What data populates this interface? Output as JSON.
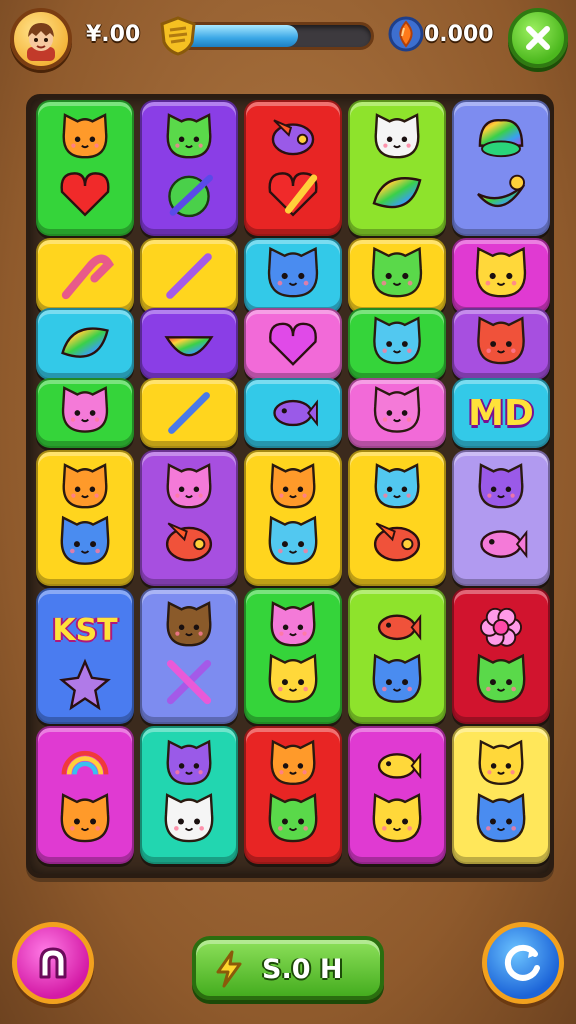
{
  "header": {
    "coin_value": "¥.00",
    "level_progress": 0.62,
    "gem_value": "0.000"
  },
  "footer": {
    "boost_label": "S.0 H"
  },
  "colors": {
    "green": "#35d43a",
    "purple": "#8a3ee6",
    "red": "#e82524",
    "lime": "#8ee32c",
    "periwinkle": "#7d8cf0",
    "yellow": "#ffd51e",
    "cyan": "#33c9e8",
    "magenta": "#e03ad2",
    "pink": "#f26ad8",
    "violet": "#a74fe0",
    "lilac": "#b19af0",
    "blue": "#4a7cf0",
    "crimson": "#d1142e",
    "teal": "#22d6b0",
    "lightyellow": "#ffe75a"
  },
  "board": {
    "tiles": [
      {
        "color": "green",
        "top": "cat-orange",
        "bottom": "heart-red"
      },
      {
        "color": "purple",
        "top": "cat-green",
        "bottom": "apple-pencil"
      },
      {
        "color": "red",
        "top": "bird-purple",
        "bottom": "heart-pencil"
      },
      {
        "color": "lime",
        "top": "cat-white",
        "bottom": "leaf-rainbow"
      },
      {
        "color": "periwinkle",
        "top": "rainbow-blob",
        "bottom": "moon-rainbow"
      },
      {
        "color": "yellow",
        "top": "magnet-pencil",
        "bottom": ""
      },
      {
        "color": "yellow",
        "top": "pencil-purple",
        "bottom": ""
      },
      {
        "color": "cyan",
        "top": "cat-blue",
        "bottom": ""
      },
      {
        "color": "yellow",
        "top": "cat-green",
        "bottom": ""
      },
      {
        "color": "magenta",
        "top": "cat-yellow",
        "bottom": ""
      },
      {
        "color": "cyan",
        "top": "leaf-rainbow",
        "bottom": ""
      },
      {
        "color": "purple",
        "top": "watermelon",
        "bottom": ""
      },
      {
        "color": "pink",
        "top": "heart-magenta",
        "bottom": ""
      },
      {
        "color": "green",
        "top": "cat-cyan",
        "bottom": ""
      },
      {
        "color": "violet",
        "top": "cat-red",
        "bottom": ""
      },
      {
        "color": "green",
        "top": "cat-pink",
        "bottom": ""
      },
      {
        "color": "yellow",
        "top": "pencil-blue",
        "bottom": ""
      },
      {
        "color": "cyan",
        "top": "fish-purple",
        "bottom": ""
      },
      {
        "color": "pink",
        "top": "cat-pink",
        "bottom": ""
      },
      {
        "color": "cyan",
        "top": "text",
        "bottom": "",
        "text": "MD"
      },
      {
        "color": "yellow",
        "top": "axolotl-orange",
        "bottom": "cat-blue"
      },
      {
        "color": "violet",
        "top": "cat-pink",
        "bottom": "bird-red"
      },
      {
        "color": "yellow",
        "top": "cat-orange",
        "bottom": "cat-cyan"
      },
      {
        "color": "yellow",
        "top": "cat-cyan",
        "bottom": "bird-red"
      },
      {
        "color": "lilac",
        "top": "cat-purple",
        "bottom": "fish-pink"
      },
      {
        "color": "blue",
        "top": "text",
        "bottom": "star-purple",
        "text": "KST"
      },
      {
        "color": "periwinkle",
        "top": "cat-brown",
        "bottom": "pencils-cross"
      },
      {
        "color": "green",
        "top": "cat-pink",
        "bottom": "cat-yellow"
      },
      {
        "color": "lime",
        "top": "fish-red",
        "bottom": "cat-blue"
      },
      {
        "color": "crimson",
        "top": "flower-pink",
        "bottom": "cat-green"
      },
      {
        "color": "magenta",
        "top": "rainbow",
        "bottom": "cat-orange"
      },
      {
        "color": "teal",
        "top": "cat-purple",
        "bottom": "cat-white"
      },
      {
        "color": "red",
        "top": "cat-orange",
        "bottom": "cat-green"
      },
      {
        "color": "magenta",
        "top": "fish-yellow",
        "bottom": "cat-yellow"
      },
      {
        "color": "lightyellow",
        "top": "cat-yellow",
        "bottom": "cat-blue"
      }
    ]
  }
}
